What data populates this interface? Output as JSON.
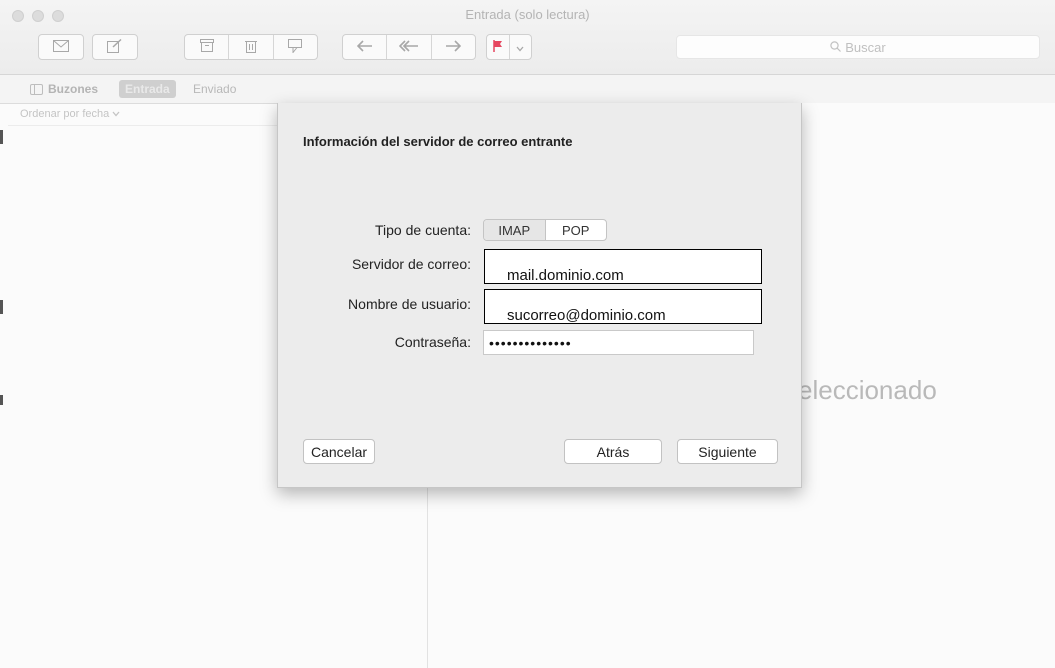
{
  "window": {
    "title": "Entrada (solo lectura)"
  },
  "toolbar": {
    "search_placeholder": "Buscar",
    "icons": [
      "envelope-icon",
      "compose-icon",
      "archive-icon",
      "trash-icon",
      "junk-icon",
      "reply-icon",
      "reply-all-icon",
      "forward-icon",
      "flag-icon",
      "chevron-down-icon",
      "search-icon"
    ],
    "flag_color": "#e6465f"
  },
  "favorites": {
    "mailboxes": "Buzones",
    "inbox": "Entrada",
    "sent": "Enviado"
  },
  "message_list": {
    "sort_label": "Ordenar por fecha"
  },
  "preview": {
    "empty_text": "eleccionado"
  },
  "dialog": {
    "title": "Información del servidor de correo entrante",
    "account_type_label": "Tipo de cuenta:",
    "account_types": [
      "IMAP",
      "POP"
    ],
    "selected_account_type": "IMAP",
    "server_label": "Servidor de correo:",
    "server_value": "mail.dominio.com",
    "username_label": "Nombre de usuario:",
    "username_value": "sucorreo@dominio.com",
    "password_label": "Contraseña:",
    "password_value": "••••••••••••••",
    "cancel_label": "Cancelar",
    "back_label": "Atrás",
    "next_label": "Siguiente"
  }
}
